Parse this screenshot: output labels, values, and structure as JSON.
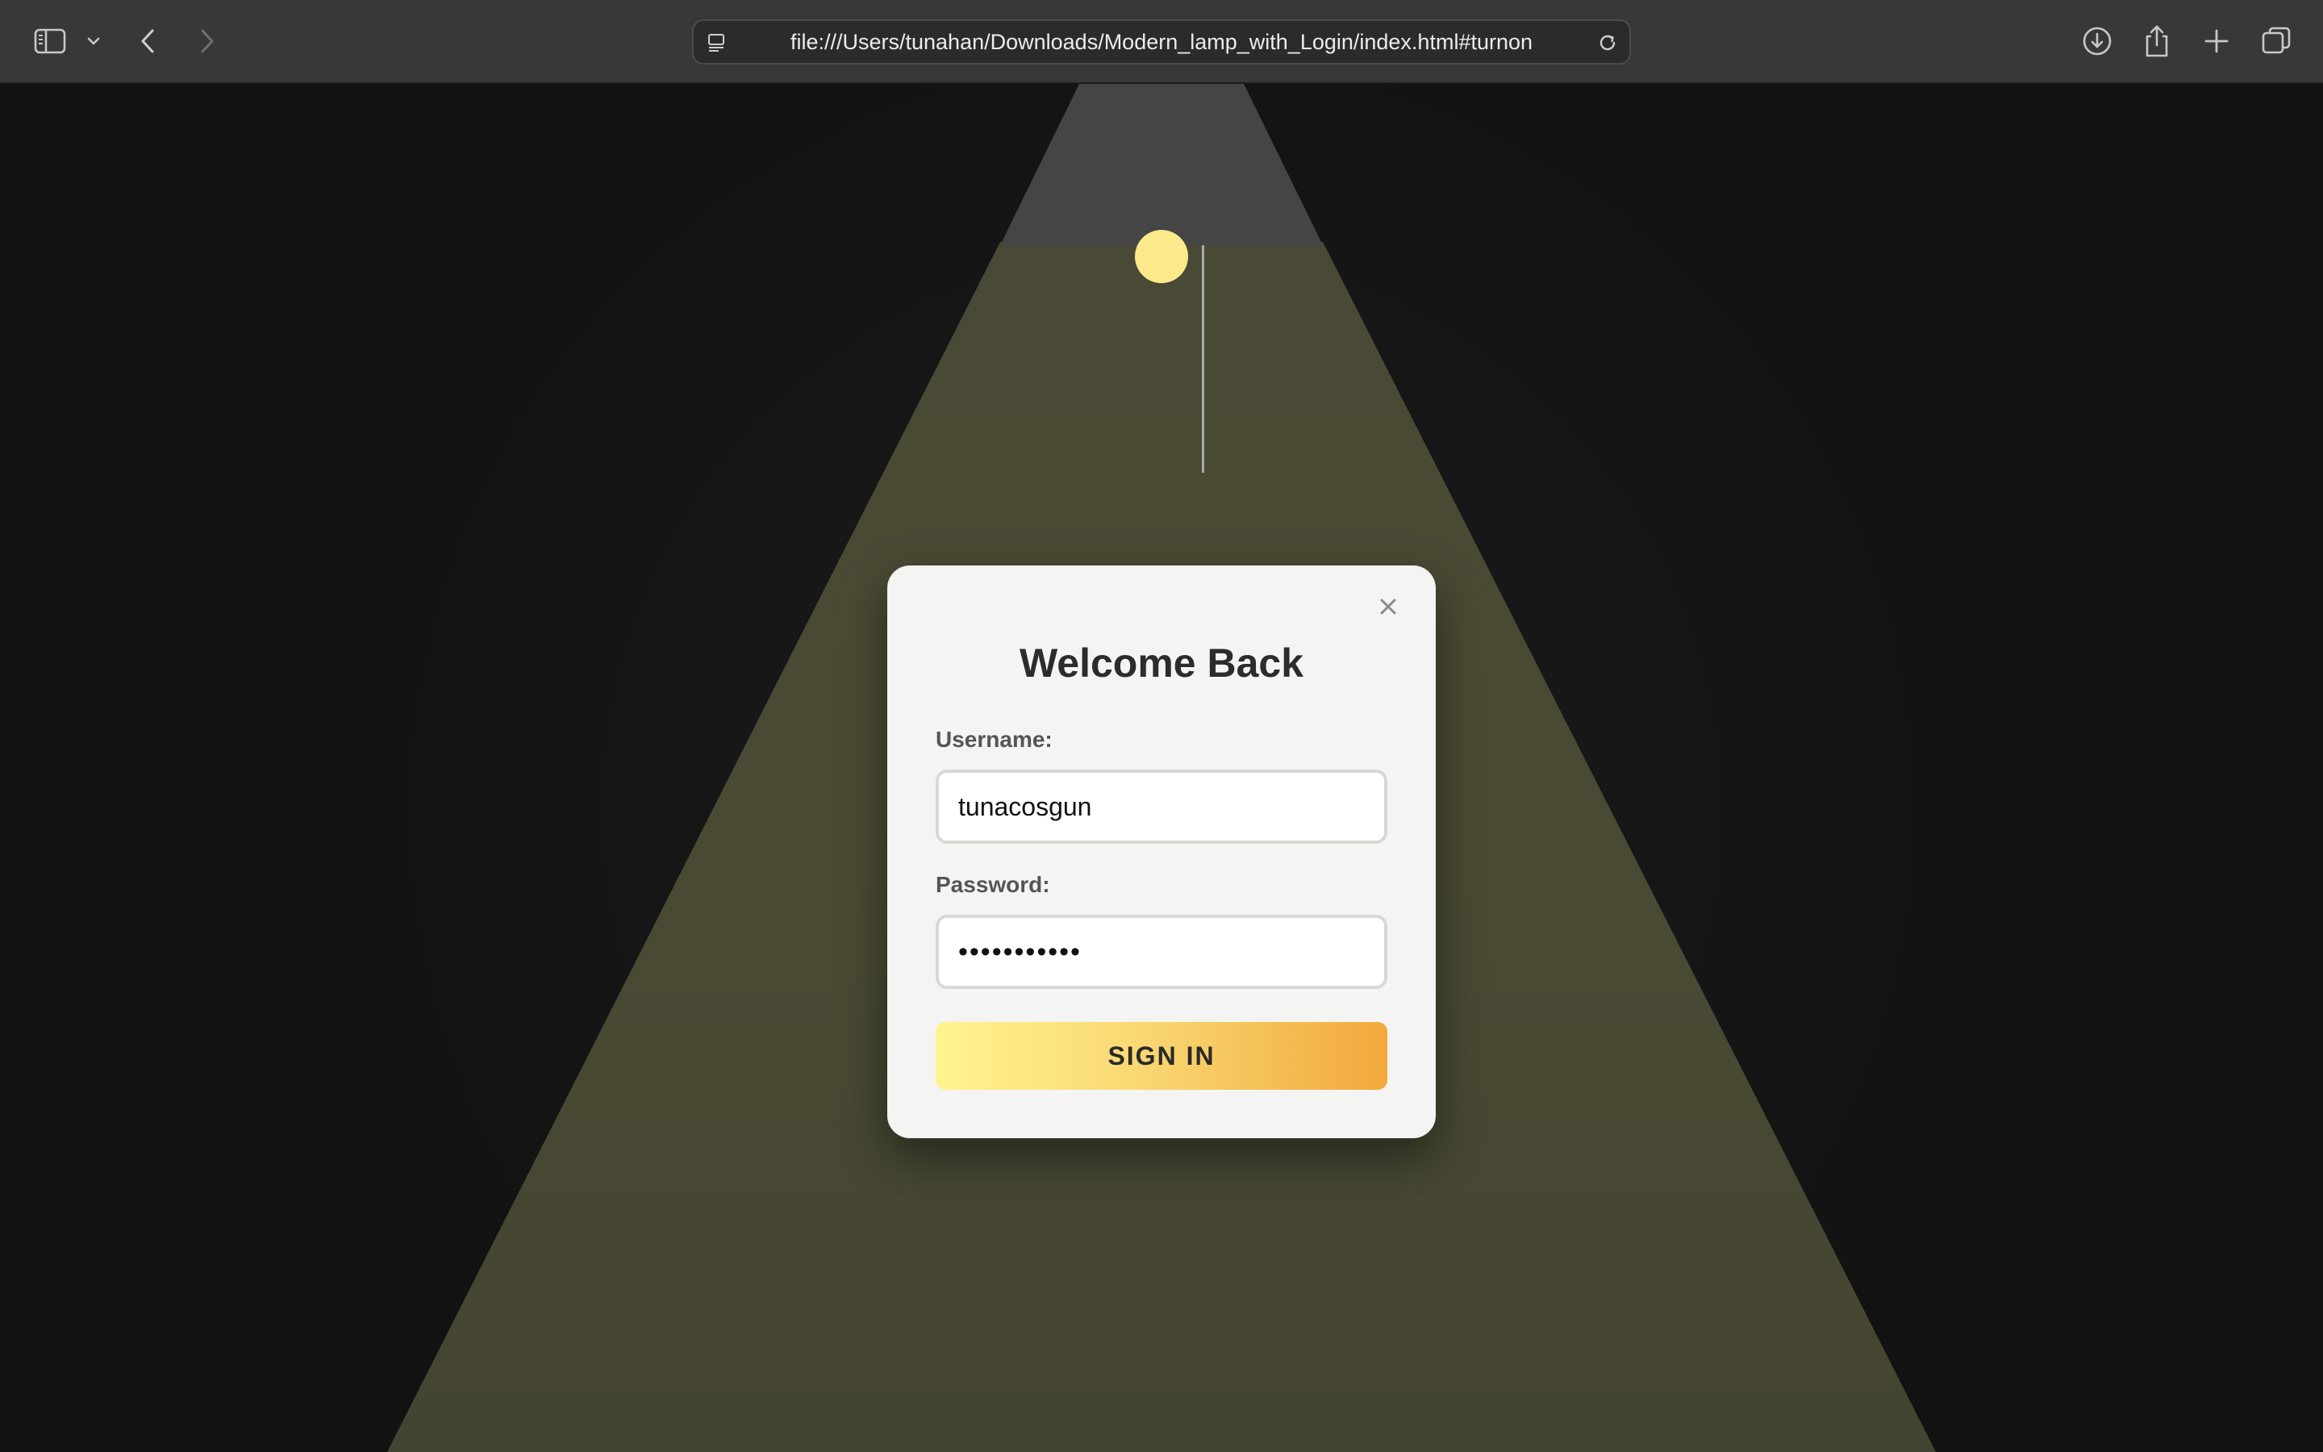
{
  "browser": {
    "url": "file:///Users/tunahan/Downloads/Modern_lamp_with_Login/index.html#turnon",
    "icons": {
      "sidebar": "sidebar-icon",
      "sidebar_menu": "chevron-down-icon",
      "back": "chevron-left-icon",
      "forward": "chevron-right-icon",
      "page": "page-format-icon",
      "reload": "reload-icon",
      "downloads": "download-icon",
      "share": "share-icon",
      "new_tab": "plus-icon",
      "tab_overview": "tabs-icon"
    }
  },
  "scene": {
    "lamp_state": "on",
    "colors": {
      "background": "#141414",
      "lamp_shade": "#454545",
      "bulb": "#fbe98c",
      "light_beam": "#4a4a34",
      "cord": "#a9a9a9"
    }
  },
  "login": {
    "title": "Welcome Back",
    "username_label": "Username:",
    "username_value": "tunacosgun",
    "password_label": "Password:",
    "password_value": "•••••••••••",
    "signin_label": "SIGN IN",
    "close_icon": "close-icon",
    "colors": {
      "card": "#f4f4f2",
      "button_gradient_start": "#fff48f",
      "button_gradient_end": "#f2a83c",
      "title": "#2c2c2c"
    }
  }
}
